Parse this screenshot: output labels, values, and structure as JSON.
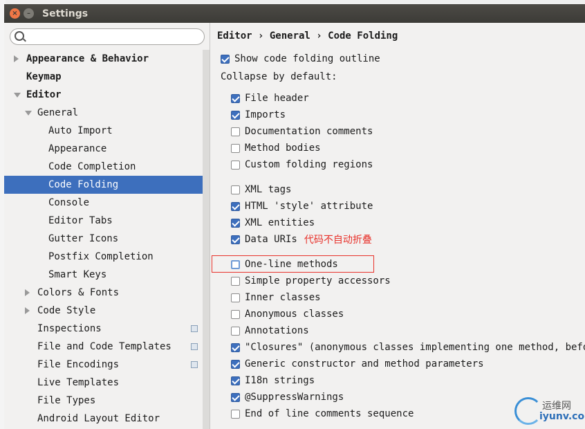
{
  "window": {
    "title": "Settings"
  },
  "search": {
    "placeholder": ""
  },
  "sidebar": {
    "items": [
      {
        "label": "Appearance & Behavior",
        "level": 0,
        "arrow": "right",
        "bold": true
      },
      {
        "label": "Keymap",
        "level": 0,
        "arrow": "none",
        "bold": true
      },
      {
        "label": "Editor",
        "level": 0,
        "arrow": "down",
        "bold": true
      },
      {
        "label": "General",
        "level": 1,
        "arrow": "down"
      },
      {
        "label": "Auto Import",
        "level": 2
      },
      {
        "label": "Appearance",
        "level": 2
      },
      {
        "label": "Code Completion",
        "level": 2
      },
      {
        "label": "Code Folding",
        "level": 2,
        "selected": true
      },
      {
        "label": "Console",
        "level": 2
      },
      {
        "label": "Editor Tabs",
        "level": 2
      },
      {
        "label": "Gutter Icons",
        "level": 2
      },
      {
        "label": "Postfix Completion",
        "level": 2
      },
      {
        "label": "Smart Keys",
        "level": 2
      },
      {
        "label": "Colors & Fonts",
        "level": 1,
        "arrow": "right"
      },
      {
        "label": "Code Style",
        "level": 1,
        "arrow": "right"
      },
      {
        "label": "Inspections",
        "level": 1,
        "copy_icon": true
      },
      {
        "label": "File and Code Templates",
        "level": 1,
        "copy_icon": true
      },
      {
        "label": "File Encodings",
        "level": 1,
        "copy_icon": true
      },
      {
        "label": "Live Templates",
        "level": 1
      },
      {
        "label": "File Types",
        "level": 1
      },
      {
        "label": "Android Layout Editor",
        "level": 1
      }
    ]
  },
  "main": {
    "breadcrumb": "Editor › General › Code Folding",
    "show_outline": {
      "label": "Show code folding outline",
      "checked": true
    },
    "collapse_label": "Collapse by default:",
    "options": [
      {
        "label": "File header",
        "checked": true
      },
      {
        "label": "Imports",
        "checked": true
      },
      {
        "label": "Documentation comments",
        "checked": false
      },
      {
        "label": "Method bodies",
        "checked": false
      },
      {
        "label": "Custom folding regions",
        "checked": false
      },
      {
        "label": "XML tags",
        "checked": false
      },
      {
        "label": "HTML 'style' attribute",
        "checked": true
      },
      {
        "label": "XML entities",
        "checked": true
      },
      {
        "label": "Data URIs",
        "checked": true
      },
      {
        "label": "One-line methods",
        "checked": false,
        "focused": true
      },
      {
        "label": "Simple property accessors",
        "checked": false
      },
      {
        "label": "Inner classes",
        "checked": false
      },
      {
        "label": "Anonymous classes",
        "checked": false
      },
      {
        "label": "Annotations",
        "checked": false
      },
      {
        "label": "\"Closures\" (anonymous classes implementing one method, before",
        "checked": true
      },
      {
        "label": "Generic constructor and method parameters",
        "checked": true
      },
      {
        "label": "I18n strings",
        "checked": true
      },
      {
        "label": "@SuppressWarnings",
        "checked": true
      },
      {
        "label": "End of line comments sequence",
        "checked": false
      }
    ],
    "annotation": "代码不自动折叠"
  },
  "watermark": {
    "top": "运维网",
    "bottom": "iyunv.com"
  },
  "colors": {
    "selection": "#3d6fbd",
    "annotation": "#e8312a",
    "titlebar": "#3c3b37"
  }
}
